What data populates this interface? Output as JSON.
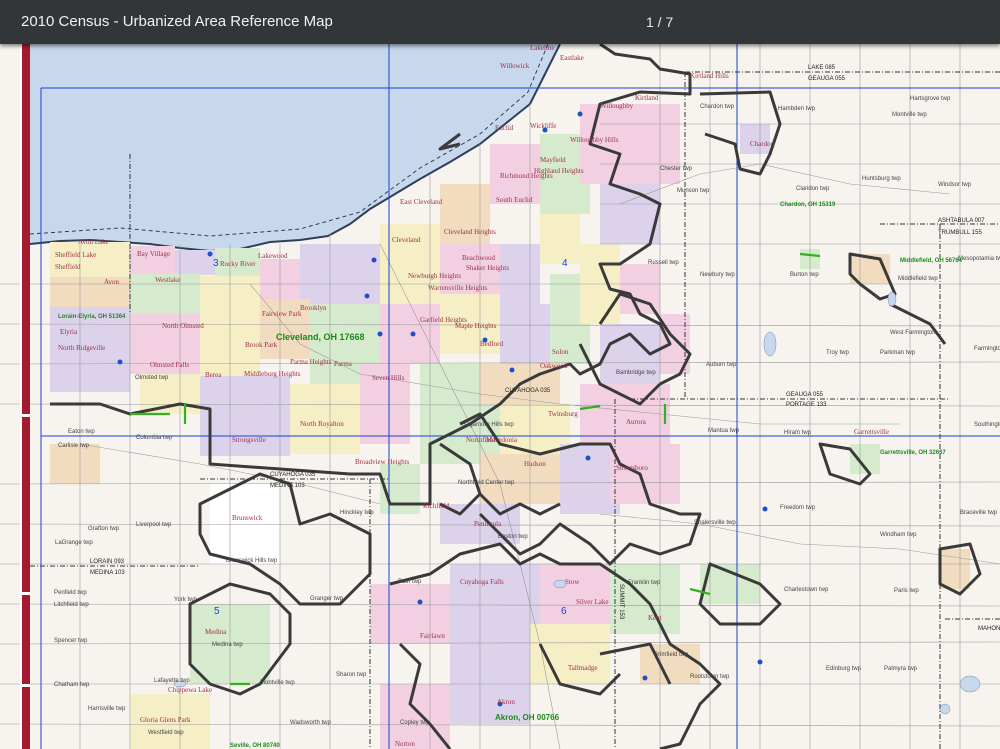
{
  "viewer": {
    "title": "2010 Census - Urbanized Area Reference Map",
    "page_counter": "1 / 7"
  },
  "map": {
    "places": [
      {
        "id": "willowick",
        "label": "Willowick"
      },
      {
        "id": "eastlake",
        "label": "Eastlake"
      },
      {
        "id": "lakeline",
        "label": "Lakeline"
      },
      {
        "id": "kirtland-hills",
        "label": "Kirtland Hills"
      },
      {
        "id": "kirtland",
        "label": "Kirtland"
      },
      {
        "id": "willoughby",
        "label": "Willoughby"
      },
      {
        "id": "wickliffe",
        "label": "Wickliffe"
      },
      {
        "id": "euclid",
        "label": "Euclid"
      },
      {
        "id": "willoughby-hills",
        "label": "Willoughby Hills"
      },
      {
        "id": "mayfield",
        "label": "Mayfield"
      },
      {
        "id": "highland-heights",
        "label": "Highland Heights"
      },
      {
        "id": "richmond-heights",
        "label": "Richmond Heights"
      },
      {
        "id": "south-euclid",
        "label": "South Euclid"
      },
      {
        "id": "east-cleveland",
        "label": "East Cleveland"
      },
      {
        "id": "cleveland-heights",
        "label": "Cleveland Heights"
      },
      {
        "id": "cleveland",
        "label": "Cleveland"
      },
      {
        "id": "lakewood",
        "label": "Lakewood"
      },
      {
        "id": "rocky-river",
        "label": "Rocky River"
      },
      {
        "id": "bay-village",
        "label": "Bay Village"
      },
      {
        "id": "avon-lake",
        "label": "Avon Lake"
      },
      {
        "id": "avon",
        "label": "Avon"
      },
      {
        "id": "westlake",
        "label": "Westlake"
      },
      {
        "id": "north-olmsted",
        "label": "North Olmsted"
      },
      {
        "id": "north-ridgeville",
        "label": "North Ridgeville"
      },
      {
        "id": "sheffield-lake",
        "label": "Sheffield Lake"
      },
      {
        "id": "sheffield",
        "label": "Sheffield"
      },
      {
        "id": "elyria",
        "label": "Elyria"
      },
      {
        "id": "brooklyn",
        "label": "Brooklyn"
      },
      {
        "id": "fairview-park",
        "label": "Fairview Park"
      },
      {
        "id": "brook-park",
        "label": "Brook Park"
      },
      {
        "id": "parma-heights",
        "label": "Parma Heights"
      },
      {
        "id": "parma",
        "label": "Parma"
      },
      {
        "id": "seven-hills",
        "label": "Seven Hills"
      },
      {
        "id": "berea",
        "label": "Berea"
      },
      {
        "id": "middleburg-heights",
        "label": "Middleburg Heights"
      },
      {
        "id": "olmsted-falls",
        "label": "Olmsted Falls"
      },
      {
        "id": "olmsted-twp",
        "label": "Olmsted twp"
      },
      {
        "id": "strongsville",
        "label": "Strongsville"
      },
      {
        "id": "north-royalton",
        "label": "North Royalton"
      },
      {
        "id": "broadview-heights",
        "label": "Broadview Heights"
      },
      {
        "id": "garfield-heights",
        "label": "Garfield Heights"
      },
      {
        "id": "maple-heights",
        "label": "Maple Heights"
      },
      {
        "id": "bedford",
        "label": "Bedford"
      },
      {
        "id": "shaker-heights",
        "label": "Shaker Heights"
      },
      {
        "id": "warrensville-heights",
        "label": "Warrensville Heights"
      },
      {
        "id": "beachwood",
        "label": "Beachwood"
      },
      {
        "id": "newburgh-heights",
        "label": "Newburgh Heights"
      },
      {
        "id": "solon",
        "label": "Solon"
      },
      {
        "id": "oakwood",
        "label": "Oakwood"
      },
      {
        "id": "twinsburg",
        "label": "Twinsburg"
      },
      {
        "id": "macedonia",
        "label": "Macedonia"
      },
      {
        "id": "sagamore-hills",
        "label": "Sagamore Hills twp"
      },
      {
        "id": "northfield",
        "label": "Northfield"
      },
      {
        "id": "richfield",
        "label": "Richfield"
      },
      {
        "id": "hinckley-twp",
        "label": "Hinckley twp"
      },
      {
        "id": "brunswick",
        "label": "Brunswick"
      },
      {
        "id": "brunswick-hills",
        "label": "Brunswick Hills twp"
      },
      {
        "id": "medina",
        "label": "Medina"
      },
      {
        "id": "medina-twp",
        "label": "Medina twp"
      },
      {
        "id": "montville-twp-m",
        "label": "Montville twp"
      },
      {
        "id": "cuyahoga-falls",
        "label": "Cuyahoga Falls"
      },
      {
        "id": "stow",
        "label": "Stow"
      },
      {
        "id": "silver-lake",
        "label": "Silver Lake"
      },
      {
        "id": "kent",
        "label": "Kent"
      },
      {
        "id": "tallmadge",
        "label": "Tallmadge"
      },
      {
        "id": "akron",
        "label": "Akron"
      },
      {
        "id": "norton",
        "label": "Norton"
      },
      {
        "id": "fairlawn",
        "label": "Fairlawn"
      },
      {
        "id": "peninsula",
        "label": "Peninsula"
      },
      {
        "id": "boston-twp",
        "label": "Boston twp"
      },
      {
        "id": "streetsboro",
        "label": "Streetsboro"
      },
      {
        "id": "aurora",
        "label": "Aurora"
      },
      {
        "id": "bainbridge-twp",
        "label": "Bainbridge twp"
      },
      {
        "id": "russell-twp",
        "label": "Russell twp"
      },
      {
        "id": "chester-twp",
        "label": "Chester twp"
      },
      {
        "id": "munson-twp",
        "label": "Munson twp"
      },
      {
        "id": "chardon",
        "label": "Chardon"
      },
      {
        "id": "chardon-twp",
        "label": "Chardon twp"
      },
      {
        "id": "hambden-twp",
        "label": "Hambden twp"
      },
      {
        "id": "montville-twp",
        "label": "Montville twp"
      },
      {
        "id": "hartsgrove-twp",
        "label": "Hartsgrove twp"
      },
      {
        "id": "claridon-twp",
        "label": "Claridon twp"
      },
      {
        "id": "huntsburg-twp",
        "label": "Huntsburg twp"
      },
      {
        "id": "windsor-twp",
        "label": "Windsor twp"
      },
      {
        "id": "newbury-twp",
        "label": "Newbury twp"
      },
      {
        "id": "burton-twp",
        "label": "Burton twp"
      },
      {
        "id": "middlefield-twp",
        "label": "Middlefield twp"
      },
      {
        "id": "mesopotamia-twp",
        "label": "Mesopotamia twp"
      },
      {
        "id": "auburn-twp",
        "label": "Auburn twp"
      },
      {
        "id": "troy-twp",
        "label": "Troy twp"
      },
      {
        "id": "parkman-twp",
        "label": "Parkman twp"
      },
      {
        "id": "mantua-twp",
        "label": "Mantua twp"
      },
      {
        "id": "hiram-twp",
        "label": "Hiram twp"
      },
      {
        "id": "freedom-twp",
        "label": "Freedom twp"
      },
      {
        "id": "windham-twp",
        "label": "Windham twp"
      },
      {
        "id": "braceville-twp",
        "label": "Braceville twp"
      },
      {
        "id": "shalersville-twp",
        "label": "Shalersville twp"
      },
      {
        "id": "charlestown-twp",
        "label": "Charlestown twp"
      },
      {
        "id": "paris-twp",
        "label": "Paris twp"
      },
      {
        "id": "edinburg-twp",
        "label": "Edinburg twp"
      },
      {
        "id": "palmyra-twp",
        "label": "Palmyra twp"
      },
      {
        "id": "rootstown-twp",
        "label": "Rootstown twp"
      },
      {
        "id": "brimfield-twp",
        "label": "Brimfield twp"
      },
      {
        "id": "franklin-twp",
        "label": "Franklin twp"
      },
      {
        "id": "eaton-twp",
        "label": "Eaton twp"
      },
      {
        "id": "columbia-twp",
        "label": "Columbia twp"
      },
      {
        "id": "carlisle-twp",
        "label": "Carlisle twp"
      },
      {
        "id": "grafton-twp",
        "label": "Grafton twp"
      },
      {
        "id": "liverpool-twp",
        "label": "Liverpool twp"
      },
      {
        "id": "lagrange-twp",
        "label": "LaGrange twp"
      },
      {
        "id": "penfield-twp",
        "label": "Penfield twp"
      },
      {
        "id": "litchfield-twp",
        "label": "Litchfield twp"
      },
      {
        "id": "york-twp",
        "label": "York twp"
      },
      {
        "id": "granger-twp",
        "label": "Granger twp"
      },
      {
        "id": "bath-twp",
        "label": "Bath twp"
      },
      {
        "id": "sharon-twp",
        "label": "Sharon twp"
      },
      {
        "id": "copley-twp",
        "label": "Copley twp"
      },
      {
        "id": "spencer-twp",
        "label": "Spencer twp"
      },
      {
        "id": "chatham-twp",
        "label": "Chatham twp"
      },
      {
        "id": "lafayette-twp",
        "label": "Lafayette twp"
      },
      {
        "id": "harrisville-twp",
        "label": "Harrisville twp"
      },
      {
        "id": "westfield-twp",
        "label": "Westfield twp"
      },
      {
        "id": "wadsworth-twp",
        "label": "Wadsworth twp"
      },
      {
        "id": "chippewa-lake",
        "label": "Chippewa Lake"
      },
      {
        "id": "gloria-glens",
        "label": "Gloria Glens Park"
      },
      {
        "id": "southington-twp",
        "label": "Southington twp"
      },
      {
        "id": "farmington-twp",
        "label": "Farmington"
      },
      {
        "id": "garrettsville",
        "label": "Garrettsville"
      },
      {
        "id": "west-farmington",
        "label": "West Farmington"
      },
      {
        "id": "northfield-center",
        "label": "Northfield Center twp"
      },
      {
        "id": "hudson",
        "label": "Hudson"
      }
    ],
    "urbanized_areas": [
      {
        "id": "cleveland-ua",
        "label": "Cleveland, OH 17668"
      },
      {
        "id": "akron-ua",
        "label": "Akron, OH 00766"
      },
      {
        "id": "lorain-elyria-ua",
        "label": "Lorain-Elyria, OH 51364"
      },
      {
        "id": "chardon-ua",
        "label": "Chardon, OH 15319"
      },
      {
        "id": "middlefield-ua",
        "label": "Middlefield, OH 56764"
      },
      {
        "id": "garrettsville-ua",
        "label": "Garrettsville, OH 32637"
      },
      {
        "id": "seville-ua",
        "label": "Seville, OH 80740"
      }
    ],
    "county_labels": [
      {
        "id": "lake-geauga",
        "label": "LAKE 085"
      },
      {
        "id": "geauga-055-top",
        "label": "GEAUGA 055"
      },
      {
        "id": "ashtabula-007",
        "label": "ASHTABULA 007"
      },
      {
        "id": "trumbull-155",
        "label": "TRUMBULL 155"
      },
      {
        "id": "geauga-055",
        "label": "GEAUGA 055"
      },
      {
        "id": "portage-133",
        "label": "PORTAGE 133"
      },
      {
        "id": "cuyahoga-035",
        "label": "CUYAHOGA 035"
      },
      {
        "id": "medina-103",
        "label": "MEDINA 103"
      },
      {
        "id": "lorain-093",
        "label": "LORAIN 093"
      },
      {
        "id": "medina-103-b",
        "label": "MEDINA 103"
      },
      {
        "id": "summit-153",
        "label": "SUMMIT 153"
      },
      {
        "id": "mahoning",
        "label": "MAHONI"
      },
      {
        "id": "cuyahoga-035-b",
        "label": "CUYAHOGA 035"
      }
    ],
    "sheet_numbers": [
      {
        "id": "sheet-3",
        "label": "3"
      },
      {
        "id": "sheet-4",
        "label": "4"
      },
      {
        "id": "sheet-5",
        "label": "5"
      },
      {
        "id": "sheet-6",
        "label": "6"
      }
    ],
    "colors": {
      "lake": "#c8d8ec",
      "urban_pink": "#f2d0e2",
      "urban_yellow": "#f6efc6",
      "urban_green": "#d6ebcd",
      "urban_purple": "#ddd2ec",
      "urban_orange": "#f2dcc0",
      "boundary": "#3a3a3a",
      "grid": "#1a3fd6",
      "ua_label": "#1a8a1a",
      "red_band": "#a31b2f"
    }
  }
}
